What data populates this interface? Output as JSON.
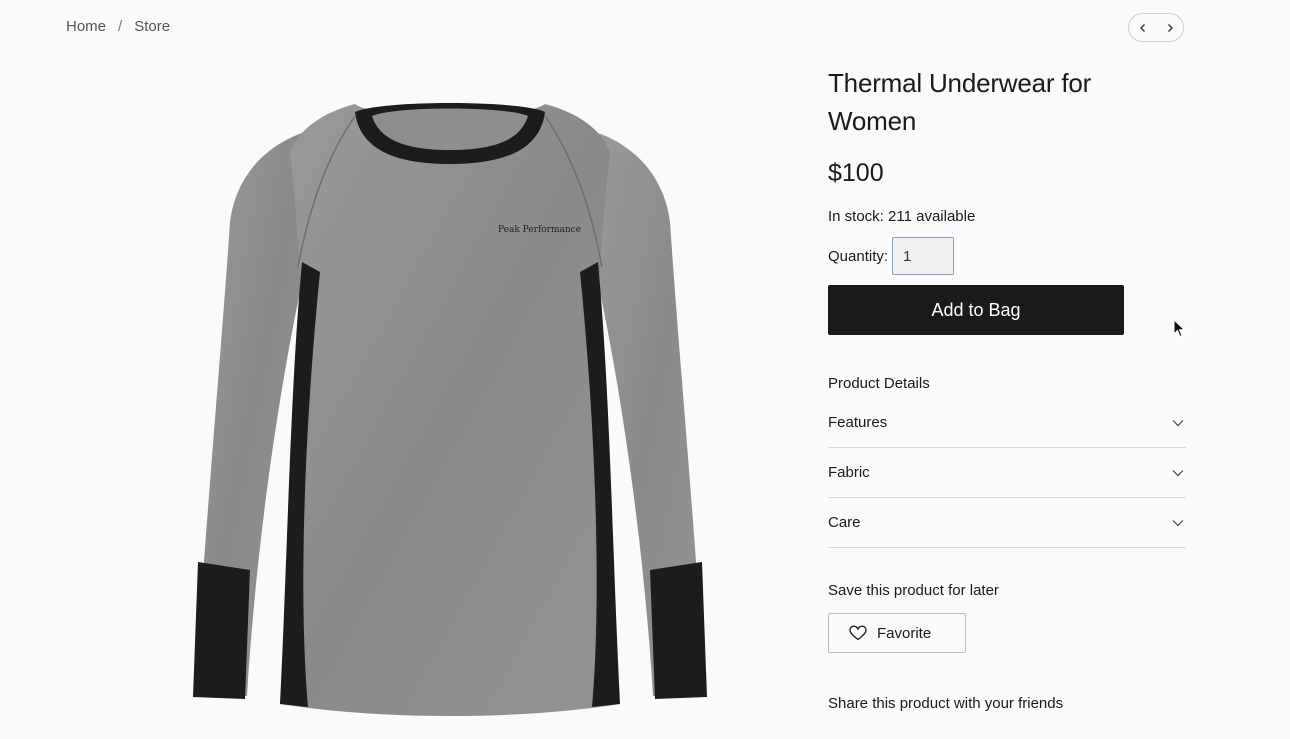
{
  "breadcrumb": {
    "home": "Home",
    "separator": "/",
    "current": "Store"
  },
  "pager": {
    "prev_icon": "chevron-left-icon",
    "next_icon": "chevron-right-icon"
  },
  "product": {
    "title": "Thermal Underwear for Women",
    "price": "$100",
    "stock": "In stock: 211 available",
    "quantity_label": "Quantity:",
    "quantity_value": "1",
    "add_to_bag": "Add to Bag",
    "image_brand": "Peak Performance"
  },
  "details": {
    "heading": "Product Details",
    "items": [
      {
        "label": "Features"
      },
      {
        "label": "Fabric"
      },
      {
        "label": "Care"
      }
    ]
  },
  "save": {
    "heading": "Save this product for later",
    "favorite_label": "Favorite",
    "icon": "heart-icon"
  },
  "share": {
    "heading": "Share this product with your friends"
  },
  "colors": {
    "button_bg": "#1a1a1a",
    "page_bg": "#fafafa",
    "shirt_gray": "#8d8d8d",
    "shirt_black": "#1c1c1e"
  }
}
